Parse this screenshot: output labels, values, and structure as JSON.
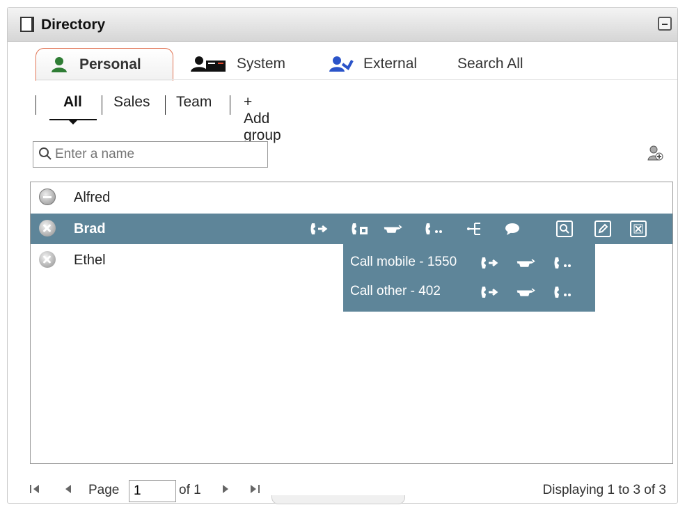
{
  "window": {
    "title": "Directory",
    "title_icon": "note-icon",
    "minimize_icon": "minimize-icon"
  },
  "tabs": [
    {
      "label": "Personal",
      "icon": "person-icon"
    },
    {
      "label": "System",
      "icon": "system-directory-icon"
    },
    {
      "label": "External",
      "icon": "external-contact-icon"
    },
    {
      "label": "Search All"
    }
  ],
  "groups": {
    "items": [
      {
        "label": "All",
        "active": true
      },
      {
        "label": "Sales"
      },
      {
        "label": "Team"
      }
    ],
    "add_group_label": "+ Add group"
  },
  "search": {
    "placeholder": "Enter a name",
    "icon": "search-icon",
    "add_contact_icon": "add-contact-icon"
  },
  "contacts": [
    {
      "name": "Alfred",
      "status": "do-not-disturb"
    },
    {
      "name": "Brad",
      "status": "offline",
      "selected": true
    },
    {
      "name": "Ethel",
      "status": "offline"
    }
  ],
  "row_actions": [
    "call-icon",
    "call-extension-icon",
    "transfer-to-voicemail-icon",
    "call-other-icon",
    "transfer-icon",
    "chat-icon",
    "view-contact-icon",
    "edit-contact-icon",
    "delete-contact-icon"
  ],
  "popup": {
    "rows": [
      {
        "label": "Call mobile - 1550"
      },
      {
        "label": "Call other - 402"
      }
    ]
  },
  "pagination": {
    "page_label": "Page",
    "page_value": "1",
    "of_label": "of 1",
    "display_text": "Displaying 1 to 3 of 3"
  },
  "colors": {
    "selected_row": "#5e8599",
    "active_tab_border": "#e17353"
  }
}
